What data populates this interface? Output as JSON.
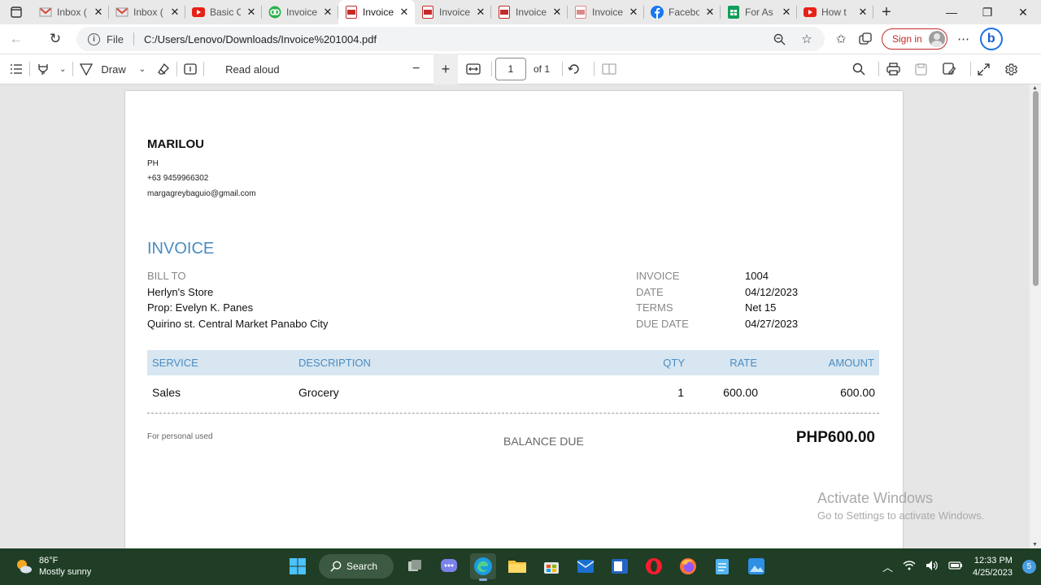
{
  "tabs": [
    {
      "title": "Inbox (",
      "icon": "gmail-icon",
      "active": false
    },
    {
      "title": "Inbox (",
      "icon": "gmail-icon",
      "active": false
    },
    {
      "title": "Basic C",
      "icon": "youtube-icon",
      "active": false
    },
    {
      "title": "Invoice",
      "icon": "invoice-app-icon",
      "active": false
    },
    {
      "title": "Invoice",
      "icon": "pdf-icon",
      "active": true
    },
    {
      "title": "Invoice",
      "icon": "pdf-icon",
      "active": false
    },
    {
      "title": "Invoice",
      "icon": "pdf-icon",
      "active": false
    },
    {
      "title": "Invoice",
      "icon": "pdf-icon",
      "active": false
    },
    {
      "title": "Facebo",
      "icon": "facebook-icon",
      "active": false
    },
    {
      "title": "For As",
      "icon": "sheets-icon",
      "active": false
    },
    {
      "title": "How t",
      "icon": "youtube-icon",
      "active": false
    }
  ],
  "address": {
    "scheme": "File",
    "url": "C:/Users/Lenovo/Downloads/Invoice%201004.pdf",
    "signin_label": "Sign in"
  },
  "pdf_toolbar": {
    "draw_label": "Draw",
    "read_aloud_label": "Read aloud",
    "page_current": "1",
    "page_total": "of 1"
  },
  "invoice": {
    "company": {
      "name": "MARILOU",
      "country": "PH",
      "phone": "+63 9459966302",
      "email": "margagreybaguio@gmail.com"
    },
    "title": "INVOICE",
    "bill_to": {
      "label": "BILL TO",
      "lines": [
        "Herlyn's Store",
        "Prop: Evelyn K. Panes",
        "Quirino st. Central Market Panabo City"
      ]
    },
    "meta": [
      {
        "label": "INVOICE",
        "value": "1004"
      },
      {
        "label": "DATE",
        "value": "04/12/2023"
      },
      {
        "label": "TERMS",
        "value": "Net 15"
      },
      {
        "label": "DUE DATE",
        "value": "04/27/2023"
      }
    ],
    "columns": [
      "SERVICE",
      "DESCRIPTION",
      "QTY",
      "RATE",
      "AMOUNT"
    ],
    "rows": [
      [
        "Sales",
        "Grocery",
        "1",
        "600.00",
        "600.00"
      ]
    ],
    "footer_note": "For personal used",
    "balance_label": "BALANCE DUE",
    "balance_value": "PHP600.00"
  },
  "watermark": {
    "line1": "Activate Windows",
    "line2": "Go to Settings to activate Windows."
  },
  "taskbar": {
    "temperature": "86°F",
    "condition": "Mostly sunny",
    "search_label": "Search",
    "time": "12:33 PM",
    "date": "4/25/2023",
    "notification_count": "5"
  },
  "colors": {
    "accent_blue": "#4a8cc0",
    "table_header_bg": "#d7e6f1",
    "taskbar_bg": "#1f3e25",
    "signin_red": "#c42b2b"
  }
}
